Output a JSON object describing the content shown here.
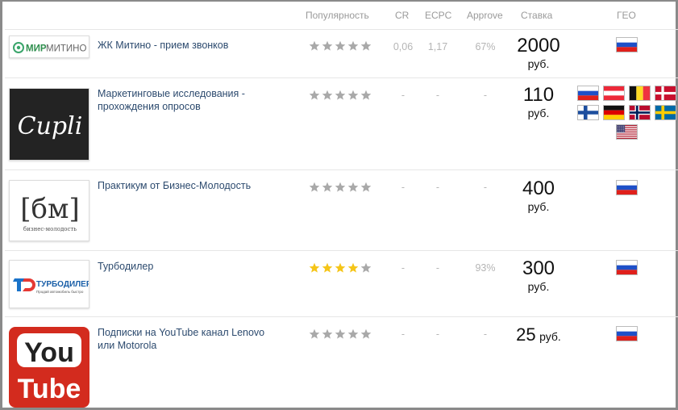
{
  "header": {
    "popularity": "Популярность",
    "cr": "CR",
    "ecpc": "ECPC",
    "approve": "Approve",
    "rate": "Ставка",
    "geo": "ГЕО"
  },
  "offers": [
    {
      "logo_text": "МИРМИТИНО",
      "name": "ЖК Митино - прием звонков",
      "stars": 0,
      "cr": "0,06",
      "ecpc": "1,17",
      "approve": "67%",
      "rate": "2000",
      "unit": "руб.",
      "geo": [
        "ru-flag-icon"
      ]
    },
    {
      "logo_text": "Cupli",
      "name": "Маркетинговые исследования - прохождения опросов",
      "stars": 0,
      "cr": "-",
      "ecpc": "-",
      "approve": "-",
      "rate": "110",
      "unit": "руб.",
      "geo": [
        "ru-flag-icon",
        "at-flag-icon",
        "be-flag-icon",
        "dk-flag-icon",
        "fi-flag-icon",
        "de-flag-icon",
        "no-flag-icon",
        "se-flag-icon",
        "us-flag-icon"
      ]
    },
    {
      "logo_text": "[бм]",
      "logo_sub": "бизнес-молодость",
      "name": "Практикум от Бизнес-Молодость",
      "stars": 0,
      "cr": "-",
      "ecpc": "-",
      "approve": "-",
      "rate": "400",
      "unit": "руб.",
      "geo": [
        "ru-flag-icon"
      ]
    },
    {
      "logo_text": "ТУРБОДИЛЕР",
      "logo_sub": "Продай автомобиль быстро",
      "name": "Турбодилер",
      "stars": 4,
      "cr": "-",
      "ecpc": "-",
      "approve": "93%",
      "rate": "300",
      "unit": "руб.",
      "geo": [
        "ru-flag-icon"
      ]
    },
    {
      "logo_text": "You",
      "logo_text2": "Tube",
      "name": "Подписки на YouTube канал Lenovo или Motorola",
      "stars": 0,
      "cr": "-",
      "ecpc": "-",
      "approve": "-",
      "rate": "25",
      "unit": "руб.",
      "geo": [
        "ru-flag-icon"
      ]
    }
  ],
  "colors": {
    "star_filled": "#f5c518",
    "star_empty": "#a9a9a9",
    "name_link": "#2c4a6e"
  }
}
